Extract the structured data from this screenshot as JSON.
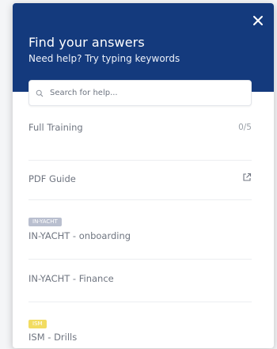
{
  "header": {
    "title": "Find your answers",
    "subtitle": "Need help? Try typing keywords"
  },
  "search": {
    "placeholder": "Search for help..."
  },
  "items": [
    {
      "label": "Full Training",
      "progress": "0/5"
    },
    {
      "label": "PDF Guide",
      "icon": "external-link-icon"
    },
    {
      "badge": "IN-YACHT",
      "label": "IN-YACHT - onboarding"
    },
    {
      "label": "IN-YACHT - Finance"
    },
    {
      "badge": "ISM",
      "label": "ISM - Drills"
    }
  ],
  "colors": {
    "header_bg": "#143a7d",
    "badge_inyacht": "#b9bfcf",
    "badge_ism": "#f2dc61"
  }
}
